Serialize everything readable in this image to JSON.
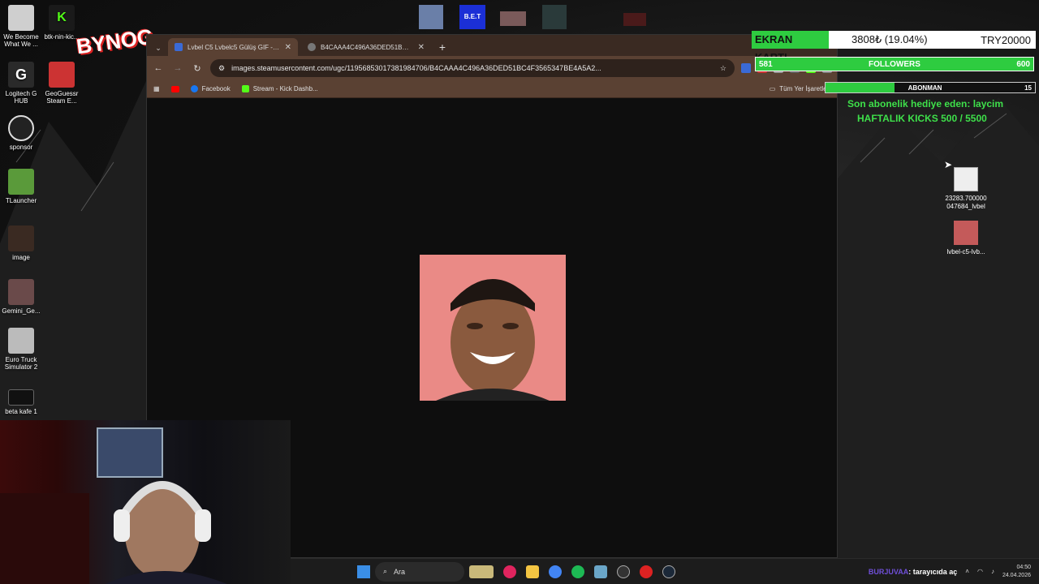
{
  "desktop_left": [
    {
      "label": "We Become What We ...",
      "color": "#cfcfcf"
    },
    {
      "label": "btk-nin-kic...",
      "color": "#1a1a1a"
    },
    {
      "label": "Logitech G HUB",
      "color": "#2a2a2a"
    },
    {
      "label": "GeoGuessr Steam E...",
      "color": "#c33"
    },
    {
      "label": "sponsor",
      "color": "#222"
    },
    {
      "label": "TLauncher",
      "color": "#5a9a3a"
    },
    {
      "label": "image",
      "color": "#3a2a22"
    },
    {
      "label": "Gemini_Ge...",
      "color": "#6a4a4a"
    },
    {
      "label": "Euro Truck Simulator 2",
      "color": "#bbb"
    },
    {
      "label": "beta kafe 1",
      "color": "#111"
    }
  ],
  "sticker_text": "BYNOG",
  "browser": {
    "tabs": [
      {
        "title": "Lvbel C5 Lvbelc5 Gülüş GIF - Lvb",
        "active": true
      },
      {
        "title": "B4CAAA4C496A36DED51BC4F",
        "active": false
      }
    ],
    "url": "images.steamusercontent.com/ugc/11956853017381984706/B4CAAA4C496A36DED51BC4F3565347BE4A5A2...",
    "bookmarks": [
      {
        "label": "Facebook",
        "color": "#1877f2"
      },
      {
        "label": "Stream - Kick Dashb...",
        "color": "#53fc18"
      }
    ],
    "bookmarks_right": "Tüm Yer İşaretleri"
  },
  "overlay": {
    "ekran_label": "EKRAN KARTI",
    "ekran_value": "3808₺ (19.04%)",
    "ekran_goal": "TRY20000",
    "followers_current": "581",
    "followers_label": "FOLLOWERS",
    "followers_goal": "600",
    "abone_label": "ABONMAN",
    "abone_value": "15",
    "gift_text": "Son abonelik hediye eden: laycim",
    "kicks_text": "HAFTALIK KICKS 500 / 5500"
  },
  "desktop_right": [
    {
      "label": "23283.700000 047684_lvbel"
    },
    {
      "label": "lvbel-c5-lvb..."
    }
  ],
  "taskbar": {
    "search_placeholder": "Ara",
    "tray_user": "BURJUVAA",
    "tray_text": ": tarayıcıda aç",
    "time": "04:50",
    "date": "24.04.2026"
  }
}
